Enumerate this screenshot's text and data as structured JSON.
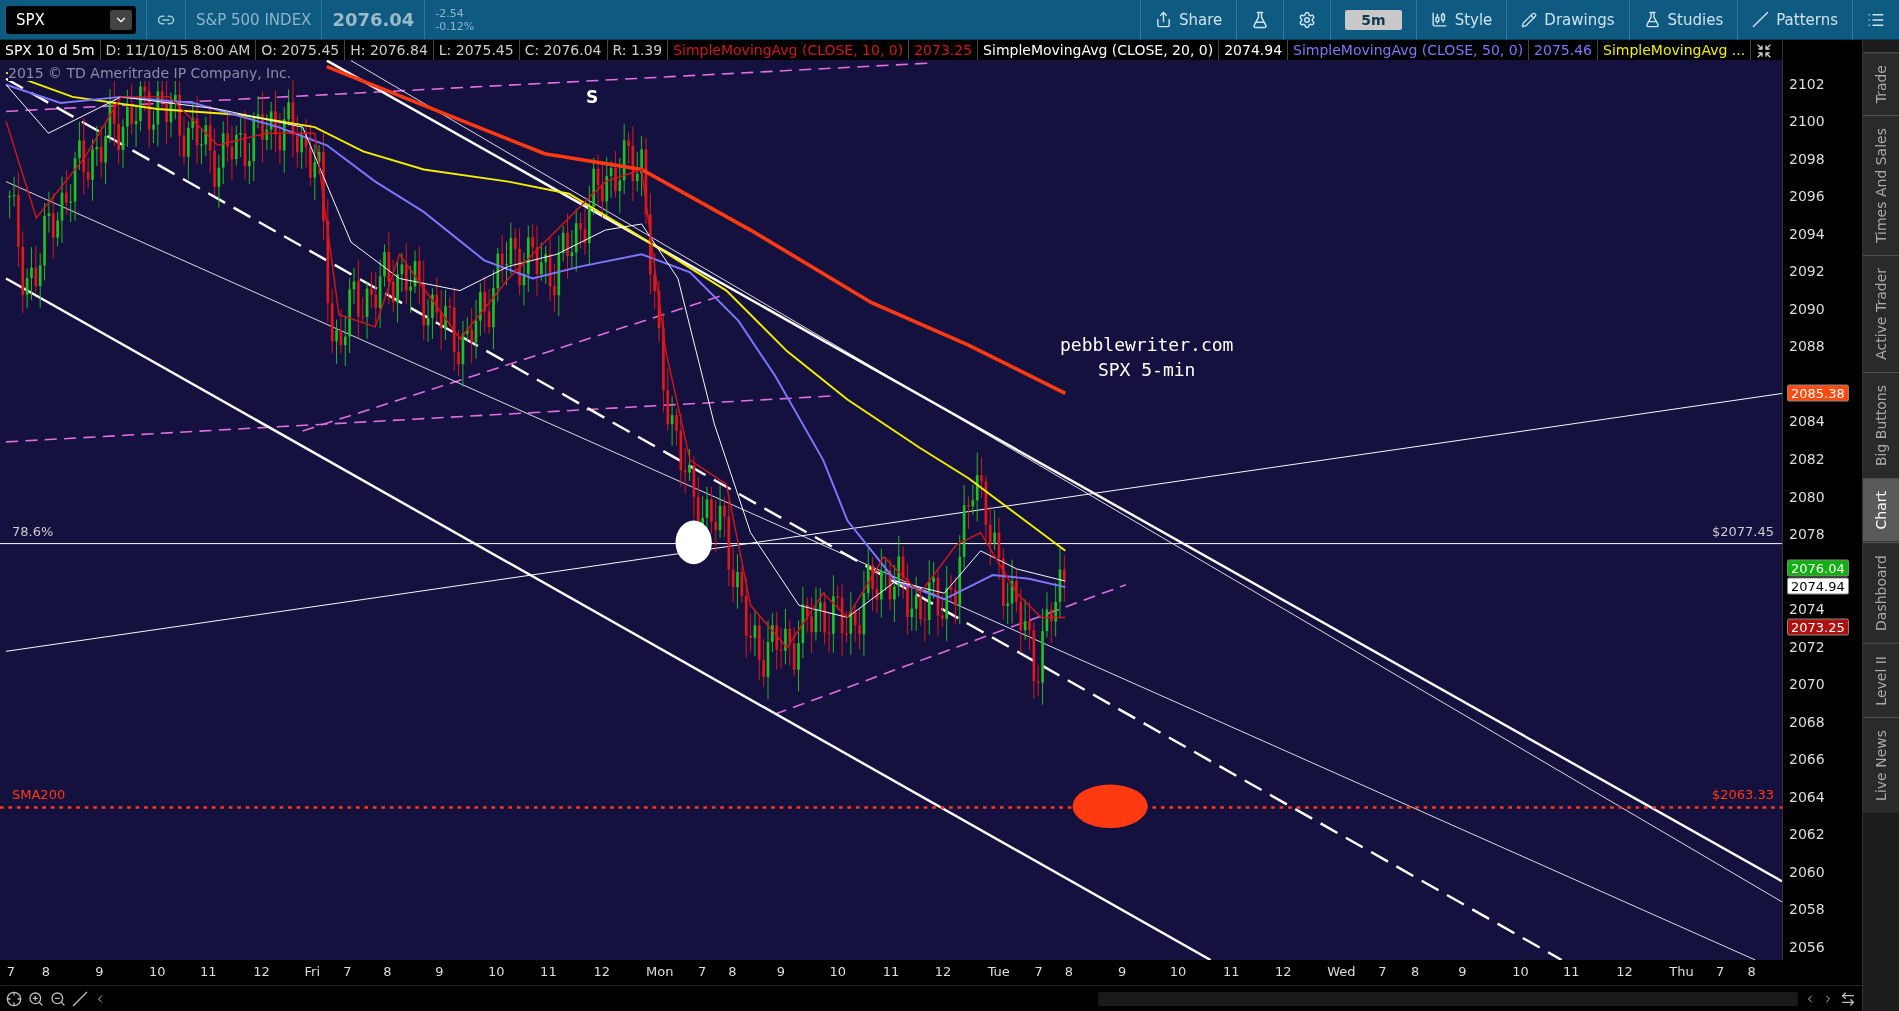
{
  "toolbar": {
    "symbol": "SPX",
    "description": "S&P 500 INDEX",
    "last": "2076.04",
    "change": "-2.54",
    "change_pct": "-0.12%",
    "buttons": [
      {
        "kind": "share",
        "label": "Share"
      },
      {
        "kind": "flask"
      },
      {
        "kind": "gear"
      },
      {
        "kind": "period",
        "label": "5m"
      },
      {
        "kind": "style",
        "label": "Style"
      },
      {
        "kind": "drawings",
        "label": "Drawings"
      },
      {
        "kind": "studies",
        "label": "Studies"
      },
      {
        "kind": "patterns",
        "label": "Patterns"
      },
      {
        "kind": "menu"
      }
    ]
  },
  "header": [
    {
      "text": "SPX 10 d 5m",
      "kind": "title"
    },
    {
      "text": "D: 11/10/15 8:00 AM",
      "kind": "info"
    },
    {
      "text": "O: 2075.45",
      "kind": "info"
    },
    {
      "text": "H: 2076.84",
      "kind": "info"
    },
    {
      "text": "L: 2075.45",
      "kind": "info"
    },
    {
      "text": "C: 2076.04",
      "kind": "info"
    },
    {
      "text": "R: 1.39",
      "kind": "info"
    },
    {
      "text": "SimpleMovingAvg (CLOSE, 10, 0)",
      "kind": "sma10"
    },
    {
      "text": "2073.25",
      "kind": "sma10"
    },
    {
      "text": "SimpleMovingAvg (CLOSE, 20, 0)",
      "kind": "sma20"
    },
    {
      "text": "2074.94",
      "kind": "sma20"
    },
    {
      "text": "SimpleMovingAvg (CLOSE, 50, 0)",
      "kind": "sma50"
    },
    {
      "text": "2075.46",
      "kind": "sma50"
    },
    {
      "text": "SimpleMovingAvg ...",
      "kind": "sma200"
    }
  ],
  "chart": {
    "copyright": "2015 © TD Ameritrade IP Company, Inc.",
    "marker": "S",
    "watermark": [
      "pebblewriter.com",
      "SPX 5-min"
    ],
    "levels": [
      {
        "label": "78.6%",
        "value": "$2077.45",
        "kind": "fib"
      },
      {
        "label": "SMA200",
        "value": "$2063.33",
        "kind": "sma"
      }
    ],
    "price_axis": [
      "2102",
      "2100",
      "2098",
      "2096",
      "2094",
      "2092",
      "2090",
      "2088",
      "2084",
      "2082",
      "2080",
      "2078",
      "2074",
      "2072",
      "2070",
      "2068",
      "2066",
      "2064",
      "2062",
      "2060",
      "2058",
      "2056"
    ],
    "price_badges": [
      {
        "text": "2085.38",
        "color": "#ff4a10"
      },
      {
        "text": "2076.04",
        "color": "#10b010"
      },
      {
        "text": "2074.94",
        "color": "#ffffff"
      },
      {
        "text": "2073.25",
        "color": "#b01010"
      }
    ],
    "time_axis": [
      "7",
      "8",
      "9",
      "10",
      "11",
      "12",
      "Fri",
      "7",
      "8",
      "9",
      "10",
      "11",
      "12",
      "Mon",
      "7",
      "8",
      "9",
      "10",
      "11",
      "12",
      "Tue",
      "7",
      "8",
      "9",
      "10",
      "11",
      "12",
      "Wed",
      "7",
      "8",
      "9",
      "10",
      "11",
      "12",
      "Thu",
      "7",
      "8"
    ]
  },
  "side_tabs": [
    {
      "label": "Trade",
      "selected": false
    },
    {
      "label": "Times And Sales",
      "selected": false
    },
    {
      "label": "Active Trader",
      "selected": false
    },
    {
      "label": "Big Buttons",
      "selected": false
    },
    {
      "label": "Chart",
      "selected": true
    },
    {
      "label": "Dashboard",
      "selected": false
    },
    {
      "label": "Level II",
      "selected": false
    },
    {
      "label": "Live News",
      "selected": false
    }
  ]
}
